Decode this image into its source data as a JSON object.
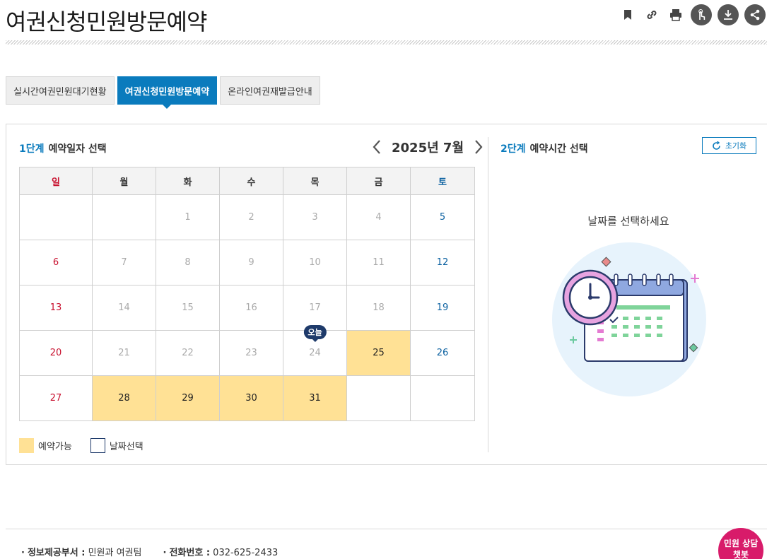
{
  "page": {
    "title": "여권신청민원방문예약"
  },
  "toolbar": {
    "icons": [
      "bookmark-icon",
      "link-icon",
      "print-icon",
      "touch-icon",
      "download-icon",
      "share-icon"
    ]
  },
  "tabs": [
    {
      "label": "실시간여권민원대기현황",
      "active": false
    },
    {
      "label": "여권신청민원방문예약",
      "active": true
    },
    {
      "label": "온라인여권재발급안내",
      "active": false
    }
  ],
  "step1": {
    "num": "1단계",
    "text": "예약일자 선택"
  },
  "calendar": {
    "month_label": "2025년 7월",
    "weekdays": [
      "일",
      "월",
      "화",
      "수",
      "목",
      "금",
      "토"
    ],
    "today_label": "오늘",
    "weeks": [
      [
        "",
        "",
        "1",
        "2",
        "3",
        "4",
        "5"
      ],
      [
        "6",
        "7",
        "8",
        "9",
        "10",
        "11",
        "12"
      ],
      [
        "13",
        "14",
        "15",
        "16",
        "17",
        "18",
        "19"
      ],
      [
        "20",
        "21",
        "22",
        "23",
        "24",
        "25",
        "26"
      ],
      [
        "27",
        "28",
        "29",
        "30",
        "31",
        "",
        ""
      ]
    ],
    "available_days": [
      "25",
      "28",
      "29",
      "30",
      "31"
    ],
    "today": "24"
  },
  "legend": {
    "available": "예약가능",
    "selected": "날짜선택"
  },
  "step2": {
    "num": "2단계",
    "text": "예약시간 선택"
  },
  "reset_label": "초기화",
  "select_message": "날짜를 선택하세요",
  "footer": {
    "dept_label": "정보제공부서 :",
    "dept_value": "민원과 여권팀",
    "phone_label": "전화번호 :",
    "phone_value": "032-625-2433"
  },
  "chatbot": {
    "line1": "민원 상담",
    "line2": "챗봇"
  },
  "colors": {
    "accent": "#0a7bbd",
    "available": "#ffe195",
    "sunday": "#c8102e",
    "saturday": "#0a60a0",
    "chatbot": "#d81b6a"
  }
}
